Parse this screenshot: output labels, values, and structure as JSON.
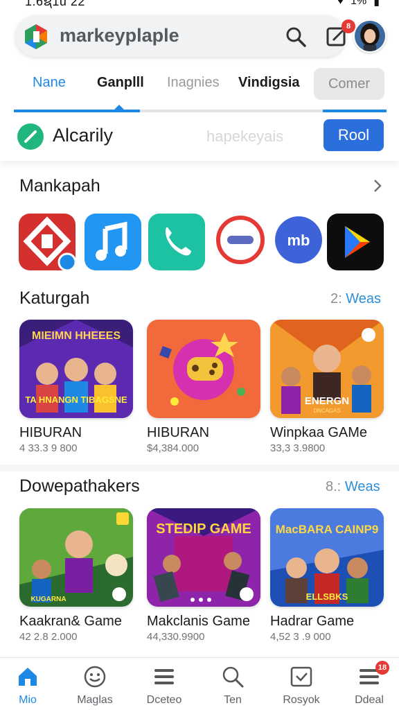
{
  "status_bar": {
    "time": "1:6ຊ1u  22",
    "battery": "1%"
  },
  "header": {
    "app_name": "markeyplaple",
    "notification_count": "8",
    "icons": {
      "logo": "brand-logo",
      "search": "search-icon",
      "notify": "notification-icon",
      "avatar": "user-avatar"
    }
  },
  "tabs": [
    {
      "label": "Nane",
      "state": "active"
    },
    {
      "label": "Ganplll",
      "state": "bold"
    },
    {
      "label": "Inagnies",
      "state": "muted"
    },
    {
      "label": "Vindigsia",
      "state": "bold"
    },
    {
      "label": "Comer",
      "state": "pill"
    }
  ],
  "filter": {
    "label": "Alcarily",
    "ghost_text": "hapekeyais",
    "button_label": "Rool"
  },
  "featured": {
    "title": "Mankapah",
    "apps": [
      "app-red-logo",
      "music-icon",
      "phone-icon",
      "chat-bubble-icon",
      "messenger-icon",
      "play-store-icon"
    ]
  },
  "section1": {
    "title": "Katurgah",
    "count": "2:",
    "more_label": "Weas",
    "cards": [
      {
        "name": "HIBURAN",
        "meta": "4 33.3 9 800",
        "art_title": "MIEIMN HHEEES",
        "art_sub": "TA HNANGN TIBAGSNE"
      },
      {
        "name": "HIBURAN",
        "meta": "$4,384.000",
        "art_title": "",
        "art_sub": ""
      },
      {
        "name": "Winpkaa GAMe",
        "meta": "33,3 3.9800",
        "art_title": "ENERGN",
        "art_sub": "DNCAGAS"
      }
    ]
  },
  "section2": {
    "title": "Dowepathakers",
    "count": "8.:",
    "more_label": "Weas",
    "cards": [
      {
        "name": "Kaakran& Game",
        "meta": "42 2.8 2.000",
        "art_title": "",
        "art_sub": "KUGARNA"
      },
      {
        "name": "Makclanis Game",
        "meta": "44,330.9900",
        "art_title": "STEDIP GAME",
        "art_sub": ""
      },
      {
        "name": "Hadrar Game",
        "meta": "4,52 3 .9 000",
        "art_title": "MacBARA CAINP9",
        "art_sub": "ELLSBKS"
      }
    ]
  },
  "colors": {
    "accent": "#1e88e5",
    "button": "#2a6fdb",
    "badge": "#e53935",
    "filter_icon": "#21b67e"
  },
  "bottom_nav": [
    {
      "label": "Mio",
      "icon": "home-icon",
      "active": true
    },
    {
      "label": "Maglas",
      "icon": "smiley-icon",
      "active": false
    },
    {
      "label": "Dceteo",
      "icon": "menu-lines-icon",
      "active": false
    },
    {
      "label": "Ten",
      "icon": "search-icon",
      "active": false
    },
    {
      "label": "Rosyok",
      "icon": "check-box-icon",
      "active": false
    },
    {
      "label": "Ddeal",
      "icon": "stack-icon",
      "active": false,
      "badge": "18"
    }
  ]
}
